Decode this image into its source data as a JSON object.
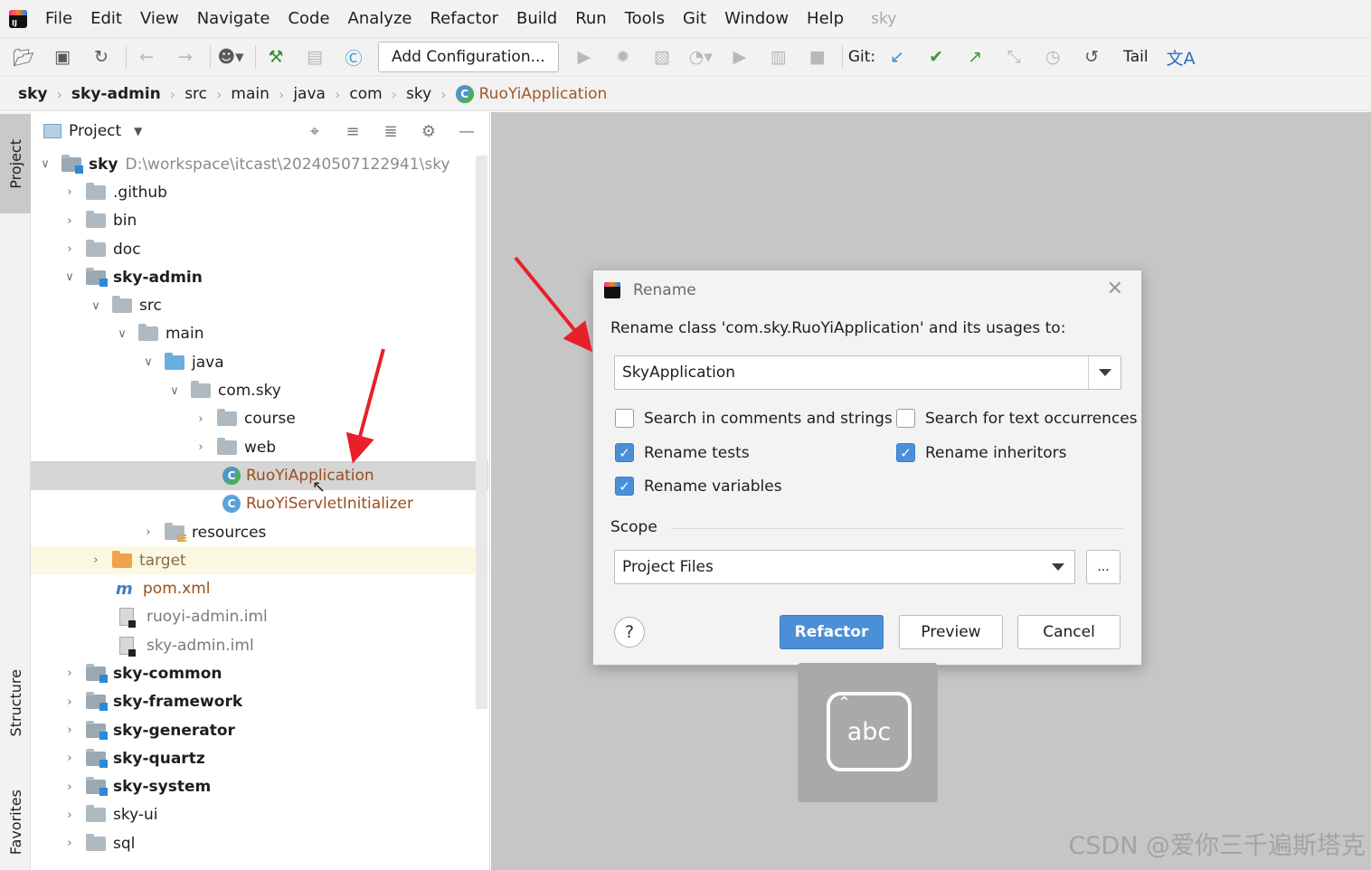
{
  "menubar": {
    "items": [
      "File",
      "Edit",
      "View",
      "Navigate",
      "Code",
      "Analyze",
      "Refactor",
      "Build",
      "Run",
      "Tools",
      "Git",
      "Window",
      "Help"
    ],
    "project_name": "sky"
  },
  "toolbar": {
    "add_configuration": "Add Configuration...",
    "git_label": "Git:",
    "tail_label": "Tail"
  },
  "breadcrumb": {
    "items": [
      "sky",
      "sky-admin",
      "src",
      "main",
      "java",
      "com",
      "sky"
    ],
    "current": "RuoYiApplication"
  },
  "sidebar_tabs": {
    "project": "Project",
    "structure": "Structure",
    "favorites": "Favorites"
  },
  "project_panel": {
    "title": "Project",
    "tree": [
      {
        "label": "sky",
        "path": "D:\\workspace\\itcast\\20240507122941\\sky"
      },
      {
        "label": ".github"
      },
      {
        "label": "bin"
      },
      {
        "label": "doc"
      },
      {
        "label": "sky-admin"
      },
      {
        "label": "src"
      },
      {
        "label": "main"
      },
      {
        "label": "java"
      },
      {
        "label": "com.sky"
      },
      {
        "label": "course"
      },
      {
        "label": "web"
      },
      {
        "label": "RuoYiApplication"
      },
      {
        "label": "RuoYiServletInitializer"
      },
      {
        "label": "resources"
      },
      {
        "label": "target"
      },
      {
        "label": "pom.xml"
      },
      {
        "label": "ruoyi-admin.iml"
      },
      {
        "label": "sky-admin.iml"
      },
      {
        "label": "sky-common"
      },
      {
        "label": "sky-framework"
      },
      {
        "label": "sky-generator"
      },
      {
        "label": "sky-quartz"
      },
      {
        "label": "sky-system"
      },
      {
        "label": "sky-ui"
      },
      {
        "label": "sql"
      }
    ]
  },
  "dialog": {
    "title": "Rename",
    "prompt": "Rename class 'com.sky.RuoYiApplication' and its usages to:",
    "new_name": "SkyApplication",
    "options": {
      "search_comments": {
        "label": "Search in comments and strings",
        "checked": false
      },
      "search_text": {
        "label": "Search for text occurrences",
        "checked": false
      },
      "rename_tests": {
        "label": "Rename tests",
        "checked": true
      },
      "rename_inheritors": {
        "label": "Rename inheritors",
        "checked": true
      },
      "rename_variables": {
        "label": "Rename variables",
        "checked": true
      }
    },
    "scope_label": "Scope",
    "scope_value": "Project Files",
    "more_button": "...",
    "help_button": "?",
    "refactor_button": "Refactor",
    "preview_button": "Preview",
    "cancel_button": "Cancel"
  },
  "ime_indicator": "abc",
  "watermark": "CSDN @爱你三千遍斯塔克",
  "colors": {
    "accent": "#4b8fd6",
    "arrow": "#e8202a",
    "selected_row": "#d5d5d5"
  }
}
